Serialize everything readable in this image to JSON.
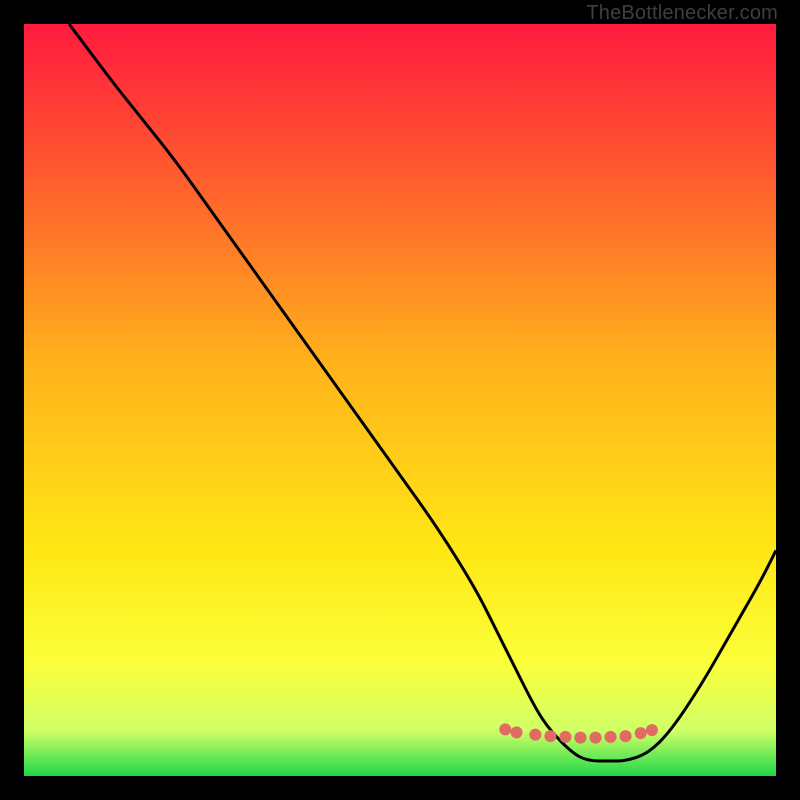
{
  "attribution": "TheBottlenecker.com",
  "chart_data": {
    "type": "line",
    "title": "",
    "xlabel": "",
    "ylabel": "",
    "xlim": [
      0,
      100
    ],
    "ylim": [
      0,
      100
    ],
    "gradient_stops": [
      {
        "offset": 0,
        "color": "#ff1a3f"
      },
      {
        "offset": 20,
        "color": "#ff5b2e"
      },
      {
        "offset": 45,
        "color": "#ffb21c"
      },
      {
        "offset": 70,
        "color": "#ffe714"
      },
      {
        "offset": 85,
        "color": "#fbff3a"
      },
      {
        "offset": 94,
        "color": "#d0ff66"
      },
      {
        "offset": 100,
        "color": "#1fd84a"
      }
    ],
    "series": [
      {
        "name": "bottleneck-curve",
        "x": [
          6,
          9,
          12,
          16,
          20,
          25,
          30,
          35,
          40,
          45,
          50,
          55,
          60,
          63,
          65,
          68,
          70,
          73,
          75,
          78,
          80,
          83,
          86,
          90,
          94,
          98,
          100
        ],
        "values": [
          100,
          96,
          92,
          87,
          82,
          75,
          68,
          61,
          54,
          47,
          40,
          33,
          25,
          19,
          15,
          9,
          6,
          3,
          2,
          2,
          2,
          3,
          6,
          12,
          19,
          26,
          30
        ]
      }
    ],
    "markers": {
      "name": "highlight-dots",
      "x": [
        64.0,
        65.5,
        68.0,
        70.0,
        72.0,
        74.0,
        76.0,
        78.0,
        80.0,
        82.0,
        83.5
      ],
      "values": [
        6.2,
        5.8,
        5.5,
        5.3,
        5.2,
        5.1,
        5.1,
        5.2,
        5.3,
        5.7,
        6.1
      ],
      "color": "#e16a62",
      "radius": 6
    }
  }
}
